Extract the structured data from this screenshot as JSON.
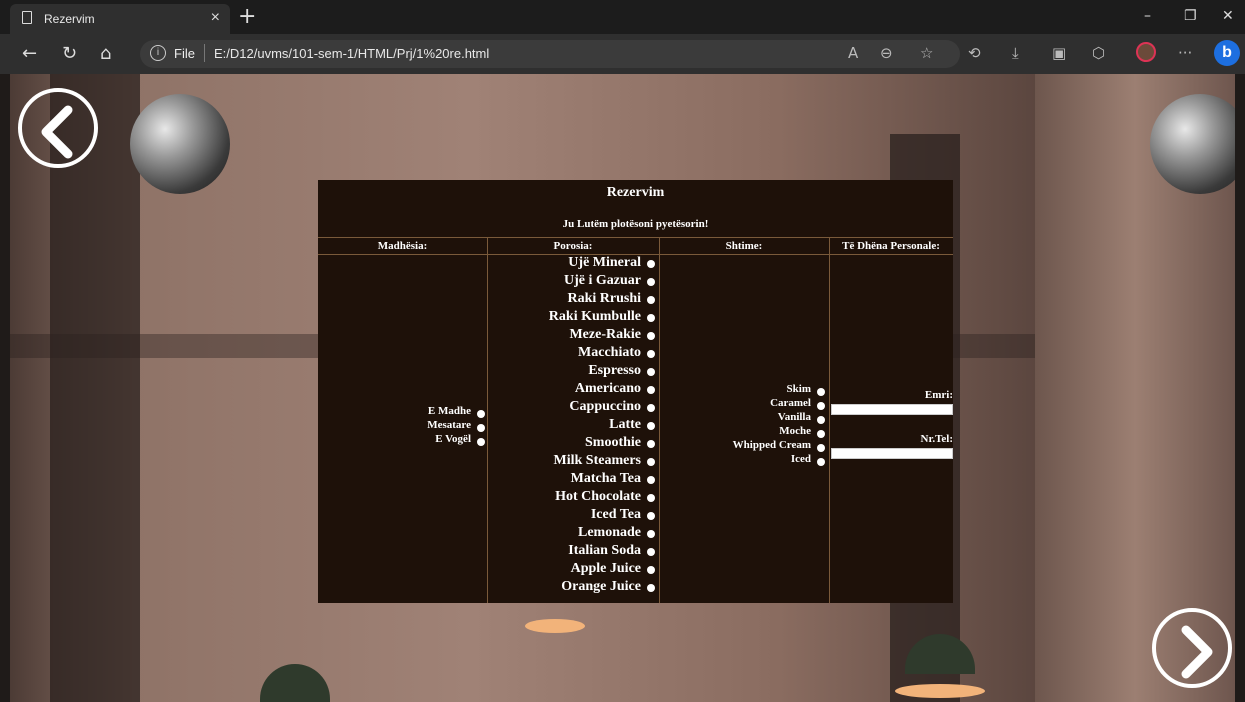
{
  "browser": {
    "tab_title": "Rezervim",
    "tab_close": "×",
    "new_tab": "+",
    "back_icon": "←",
    "reload_icon": "↻",
    "home_icon": "⌂",
    "file_label": "File",
    "url": "E:/D12/uvms/101-sem-1/HTML/Prj/1%20re.html",
    "minimize": "–",
    "restore": "❐",
    "close": "✕",
    "more": "···"
  },
  "form": {
    "title": "Rezervim",
    "subtitle": "Ju Lutëm plotësoni pyetësorin!",
    "columns": [
      "Madhësia:",
      "Porosia:",
      "Shtime:",
      "Të Dhëna Personale:"
    ],
    "sizes": [
      "E Madhe",
      "Mesatare",
      "E Vogël"
    ],
    "orders": [
      "Ujë Mineral",
      "Ujë i Gazuar",
      "Raki Rrushi",
      "Raki Kumbulle",
      "Meze-Rakie",
      "Macchiato",
      "Espresso",
      "Americano",
      "Cappuccino",
      "Latte",
      "Smoothie",
      "Milk Steamers",
      "Matcha Tea",
      "Hot Chocolate",
      "Iced Tea",
      "Lemonade",
      "Italian Soda",
      "Apple Juice",
      "Orange Juice"
    ],
    "extras": [
      "Skim",
      "Caramel",
      "Vanilla",
      "Moche",
      "Whipped Cream",
      "Iced"
    ],
    "personal": {
      "name_label": "Emri:",
      "name_value": "",
      "phone_label": "Nr.Tel:",
      "phone_value": ""
    }
  },
  "page_nav": {
    "prev_icon": "chevron-left-icon",
    "next_icon": "chevron-right-icon"
  }
}
